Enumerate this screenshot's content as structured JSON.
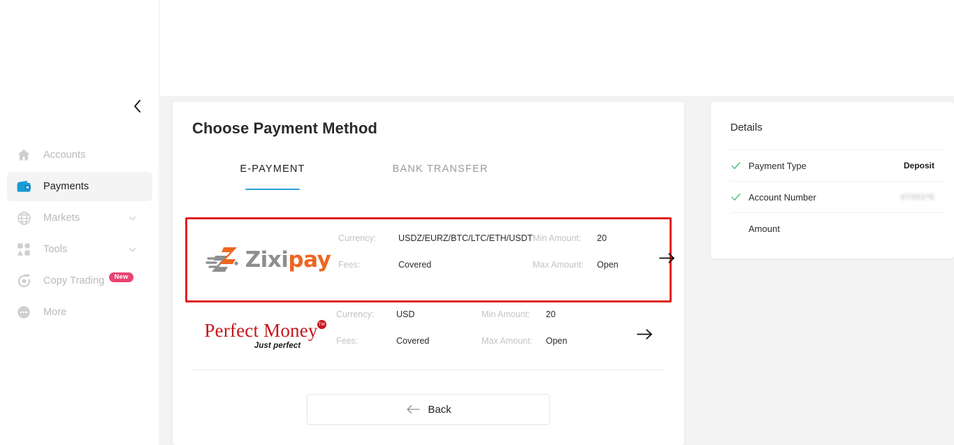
{
  "sidebar": {
    "collapse_icon": "chevron-left-icon",
    "items": [
      {
        "label": "Accounts",
        "icon": "home-icon",
        "active": false,
        "chevron": false,
        "badge": null
      },
      {
        "label": "Payments",
        "icon": "wallet-icon",
        "active": true,
        "chevron": false,
        "badge": null
      },
      {
        "label": "Markets",
        "icon": "globe-icon",
        "active": false,
        "chevron": true,
        "badge": null
      },
      {
        "label": "Tools",
        "icon": "grid-shapes-icon",
        "active": false,
        "chevron": true,
        "badge": null
      },
      {
        "label": "Copy Trading",
        "icon": "copy-trading-icon",
        "active": false,
        "chevron": false,
        "badge": "New"
      },
      {
        "label": "More",
        "icon": "ellipsis-circle-icon",
        "active": false,
        "chevron": false,
        "badge": null
      }
    ]
  },
  "main": {
    "title": "Choose Payment Method",
    "tabs": [
      {
        "label": "E-PAYMENT",
        "active": true
      },
      {
        "label": "BANK TRANSFER",
        "active": false
      }
    ],
    "labels": {
      "currency": "Currency:",
      "fees": "Fees:",
      "min_amount": "Min Amount:",
      "max_amount": "Max Amount:"
    },
    "methods": [
      {
        "name": "Zixipay",
        "logo_word_1": "Zixi",
        "logo_word_2": "pay",
        "currency": "USDZ/EURZ/BTC/LTC/ETH/USDT",
        "fees": "Covered",
        "min_amount": "20",
        "max_amount": "Open",
        "highlighted": true,
        "arrow_icon": "arrow-right-icon"
      },
      {
        "name": "Perfect Money",
        "logo_word_1": "Perfect Money",
        "logo_word_2": "Just perfect",
        "logo_tm": "TM",
        "currency": "USD",
        "fees": "Covered",
        "min_amount": "20",
        "max_amount": "Open",
        "highlighted": false,
        "arrow_icon": "arrow-right-icon"
      }
    ],
    "back_button": {
      "label": "Back",
      "icon": "arrow-left-icon"
    }
  },
  "details": {
    "title": "Details",
    "rows": [
      {
        "label": "Payment Type",
        "value": "Deposit",
        "checked": true,
        "redacted": false
      },
      {
        "label": "Account Number",
        "value": "#7901*6",
        "checked": true,
        "redacted": true
      },
      {
        "label": "Amount",
        "value": "",
        "checked": false,
        "redacted": false
      }
    ]
  },
  "colors": {
    "accent": "#2aa3d4",
    "highlight_border": "#e02020",
    "badge_new": "#e8436f",
    "check_green": "#3fbb6e",
    "zixipay_orange": "#ef6622",
    "zixipay_grey": "#8e8e8e",
    "perfect_money_red": "#c5161c",
    "page_bg": "#f3f3f3"
  }
}
